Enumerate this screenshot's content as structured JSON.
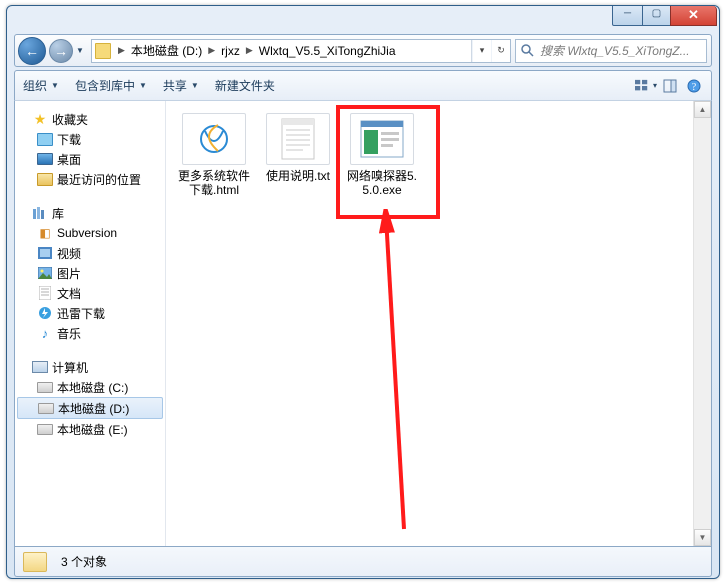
{
  "window": {
    "title": ""
  },
  "nav": {
    "breadcrumb": [
      "本地磁盘 (D:)",
      "rjxz",
      "Wlxtq_V5.5_XiTongZhiJia"
    ],
    "search_placeholder": "搜索 Wlxtq_V5.5_XiTongZ..."
  },
  "toolbar": {
    "organize": "组织",
    "include": "包含到库中",
    "share": "共享",
    "new_folder": "新建文件夹"
  },
  "tree": {
    "favorites": {
      "label": "收藏夹",
      "items": [
        {
          "label": "下载",
          "icon": "download"
        },
        {
          "label": "桌面",
          "icon": "desktop"
        },
        {
          "label": "最近访问的位置",
          "icon": "recent"
        }
      ]
    },
    "libraries": {
      "label": "库",
      "items": [
        {
          "label": "Subversion",
          "icon": "svn"
        },
        {
          "label": "视频",
          "icon": "video"
        },
        {
          "label": "图片",
          "icon": "picture"
        },
        {
          "label": "文档",
          "icon": "doc"
        },
        {
          "label": "迅雷下载",
          "icon": "xunlei"
        },
        {
          "label": "音乐",
          "icon": "music"
        }
      ]
    },
    "computer": {
      "label": "计算机",
      "items": [
        {
          "label": "本地磁盘 (C:)",
          "icon": "drive"
        },
        {
          "label": "本地磁盘 (D:)",
          "icon": "drive",
          "selected": true
        },
        {
          "label": "本地磁盘 (E:)",
          "icon": "drive"
        }
      ]
    }
  },
  "files": [
    {
      "name": "更多系统软件下载.html",
      "type": "html"
    },
    {
      "name": "使用说明.txt",
      "type": "txt"
    },
    {
      "name": "网络嗅探器5.5.0.exe",
      "type": "exe",
      "highlighted": true
    }
  ],
  "status": {
    "count_label": "3 个对象"
  }
}
